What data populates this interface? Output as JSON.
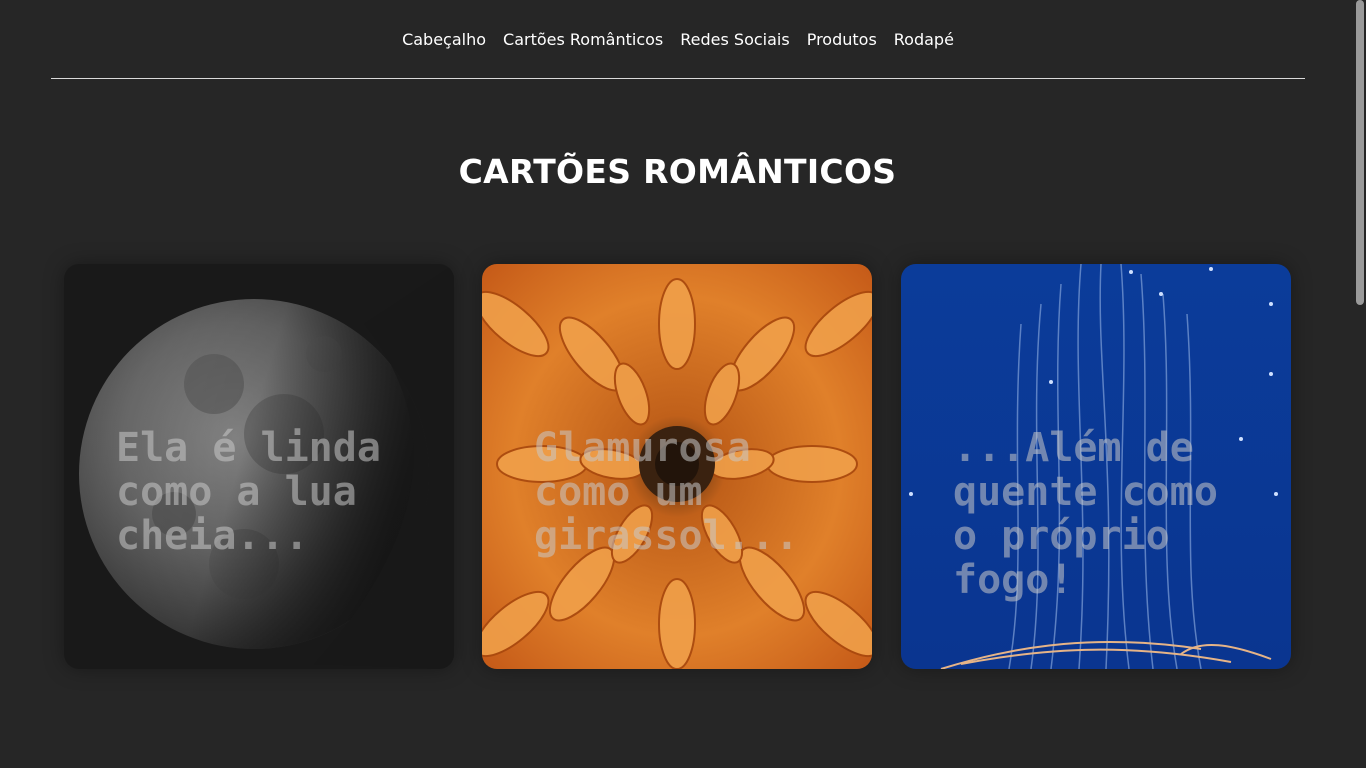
{
  "nav": {
    "items": [
      {
        "label": "Cabeçalho"
      },
      {
        "label": "Cartões Românticos"
      },
      {
        "label": "Redes Sociais"
      },
      {
        "label": "Produtos"
      },
      {
        "label": "Rodapé"
      }
    ]
  },
  "section": {
    "title": "CARTÕES ROMÂNTICOS"
  },
  "cards": [
    {
      "text": "Ela é linda como a lua cheia...",
      "image": "moon",
      "bg": "#1a1a1a"
    },
    {
      "text": "Glamurosa como um girassol...",
      "image": "orange-flower",
      "bg": "#c8641e"
    },
    {
      "text": "...Além de quente como o próprio fogo!",
      "image": "jellyfish",
      "bg": "#0a3aa0"
    }
  ]
}
